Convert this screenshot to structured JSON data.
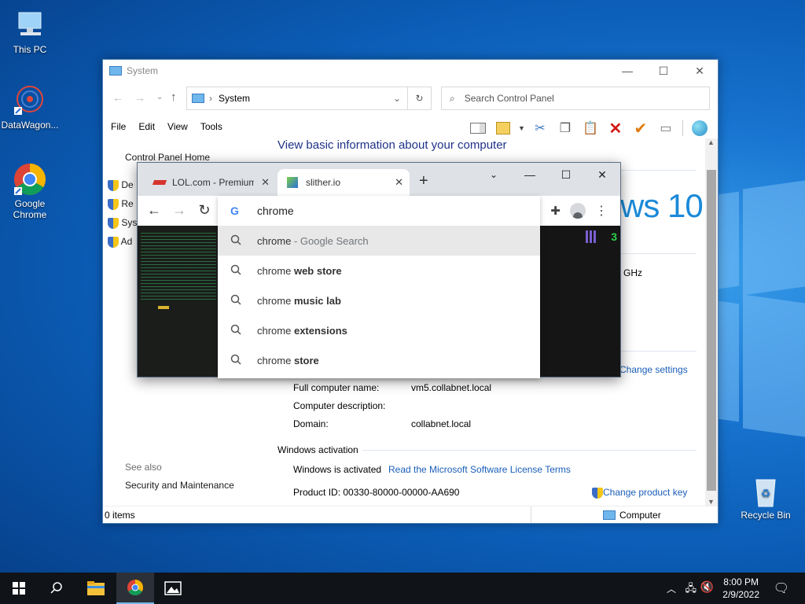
{
  "desktop": {
    "icons": [
      {
        "label": "This PC"
      },
      {
        "label": "DataWagon..."
      },
      {
        "label": "Google\nChrome"
      },
      {
        "label": "Recycle Bin"
      }
    ]
  },
  "control_panel": {
    "title": "System",
    "address": "System",
    "search_placeholder": "Search Control Panel",
    "menu": [
      "File",
      "Edit",
      "View",
      "Tools"
    ],
    "left_nav": {
      "home": "Control Panel Home",
      "items": [
        "De",
        "Re",
        "Sys",
        "Ad"
      ],
      "see_also": "See also",
      "security": "Security and Maintenance"
    },
    "heading": "View basic information about your computer",
    "brand_fragment": "ws 10",
    "ghz": "GHz",
    "change_settings": "Change settings",
    "fields": [
      {
        "label": "Full computer name:",
        "value": "vm5.collabnet.local"
      },
      {
        "label": "Computer description:",
        "value": ""
      },
      {
        "label": "Domain:",
        "value": "collabnet.local"
      }
    ],
    "activation_heading": "Windows activation",
    "activation_status": "Windows is activated",
    "license_link": "Read the Microsoft Software License Terms",
    "product_id": "Product ID: 00330-80000-00000-AA690",
    "change_key": "Change product key",
    "status_items": "0 items",
    "status_computer": "Computer"
  },
  "chrome": {
    "tabs": [
      {
        "label": "LOL.com - Premium"
      },
      {
        "label": "slither.io"
      }
    ],
    "omnibox_text": "chrome",
    "suggestions": [
      {
        "prefix": "chrome",
        "bold": "",
        "suffix": " - Google Search"
      },
      {
        "prefix": "chrome ",
        "bold": "web store",
        "suffix": ""
      },
      {
        "prefix": "chrome ",
        "bold": "music lab",
        "suffix": ""
      },
      {
        "prefix": "chrome ",
        "bold": "extensions",
        "suffix": ""
      },
      {
        "prefix": "chrome ",
        "bold": "store",
        "suffix": ""
      }
    ]
  },
  "taskbar": {
    "time": "8:00 PM",
    "date": "2/9/2022"
  }
}
